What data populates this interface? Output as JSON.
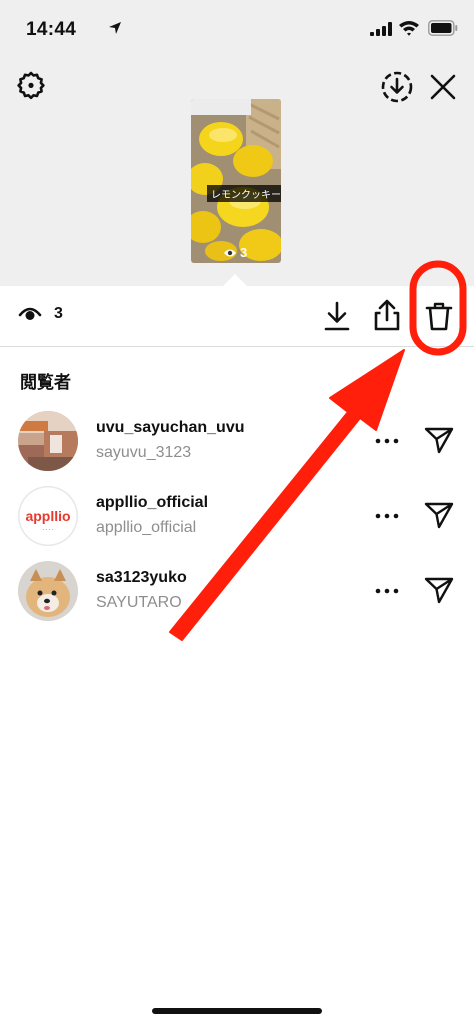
{
  "status_bar": {
    "time": "14:44"
  },
  "story": {
    "caption": "レモンクッキー",
    "views": "3"
  },
  "action_bar": {
    "view_count": "3"
  },
  "viewers": {
    "heading": "閲覧者",
    "items": [
      {
        "username": "uvu_sayuchan_uvu",
        "name": "sayuvu_3123"
      },
      {
        "username": "appllio_official",
        "name": "appllio_official",
        "logo_text": "appllio"
      },
      {
        "username": "sa3123yuko",
        "name": "SAYUTARO"
      }
    ]
  },
  "colors": {
    "annotation_red": "#ff1f0a",
    "appllio_red": "#e8392c",
    "lemon_yellow": "#f4d51c"
  }
}
